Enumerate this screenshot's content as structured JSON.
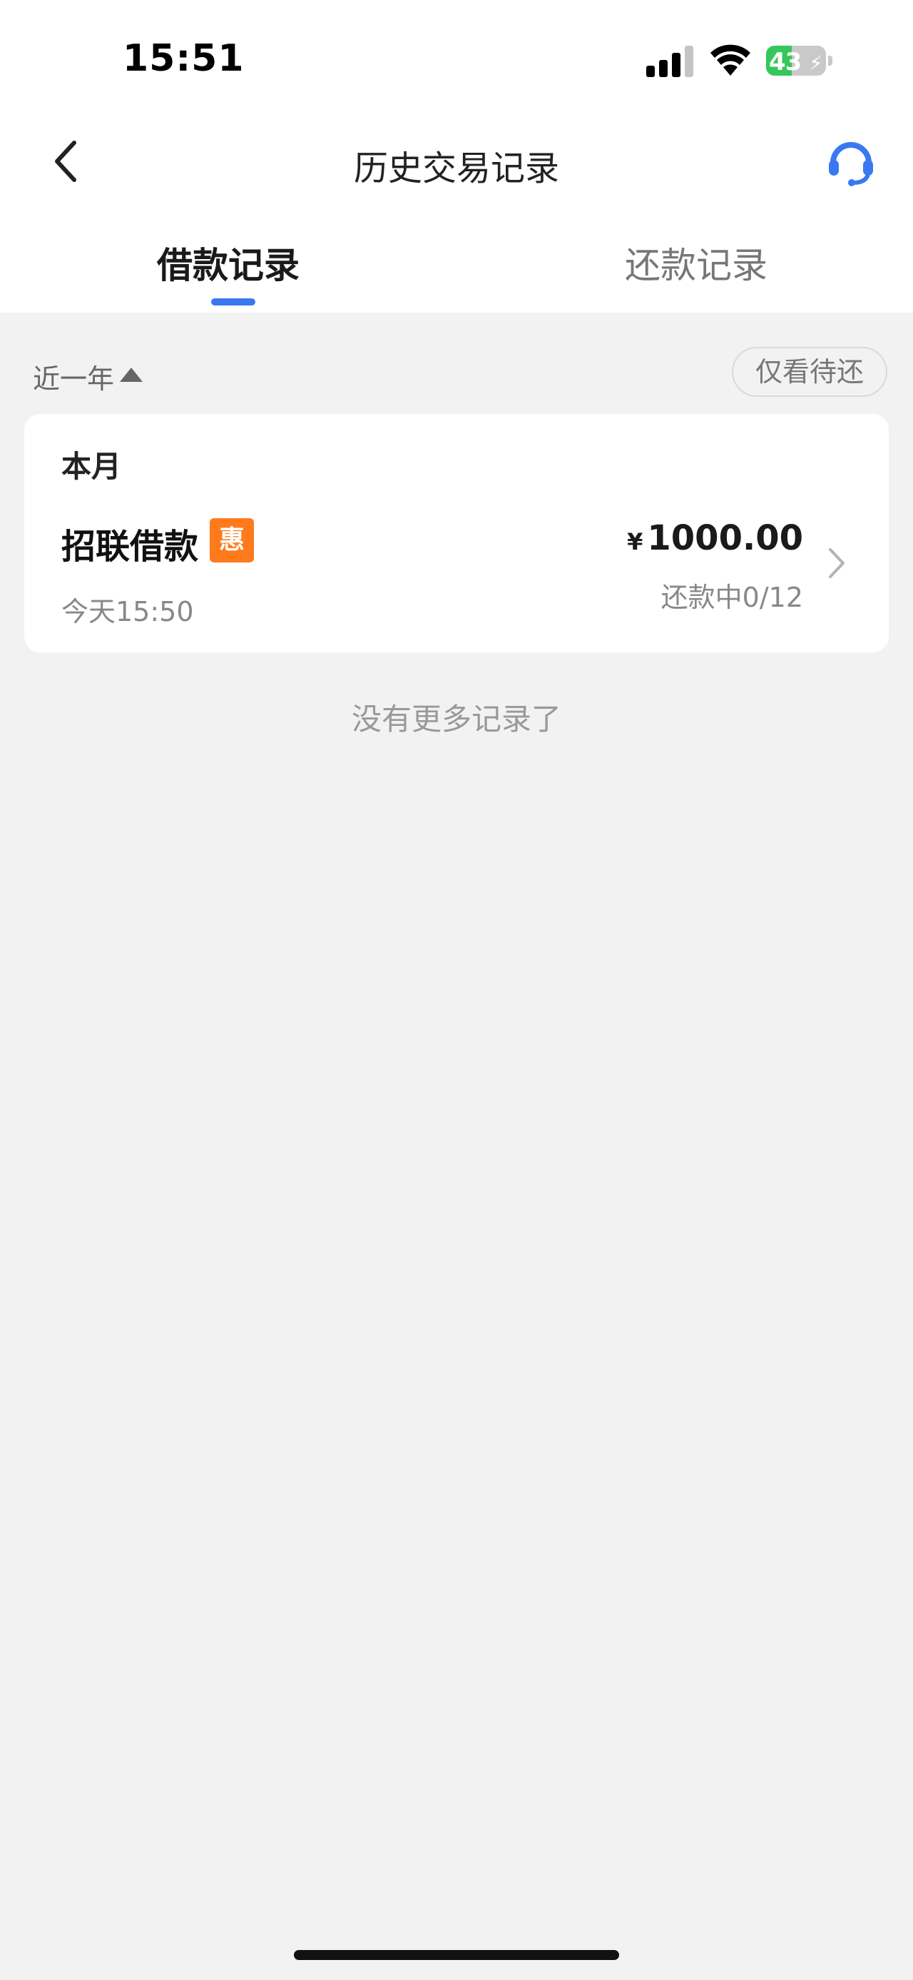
{
  "status_bar": {
    "time": "15:51",
    "battery_level": "43",
    "battery_fraction": 0.43,
    "signal_icon": "cellular-signal-icon",
    "wifi_icon": "wifi-icon",
    "battery_icon": "battery-charging-icon"
  },
  "nav": {
    "title": "历史交易记录",
    "back_icon": "chevron-left-icon",
    "service_icon": "headset-icon",
    "accent_color": "#3a78f2"
  },
  "tabs": [
    {
      "label": "借款记录",
      "active": true
    },
    {
      "label": "还款记录",
      "active": false
    }
  ],
  "filter": {
    "period": "近一年",
    "pending_only_label": "仅看待还"
  },
  "records": {
    "month": "本月",
    "items": [
      {
        "name": "招联借款",
        "badge": "惠",
        "badge_color": "#ff7a1a",
        "time": "今天15:50",
        "currency": "¥",
        "amount": "1000.00",
        "status": "还款中0/12"
      }
    ]
  },
  "footer": {
    "no_more": "没有更多记录了"
  }
}
